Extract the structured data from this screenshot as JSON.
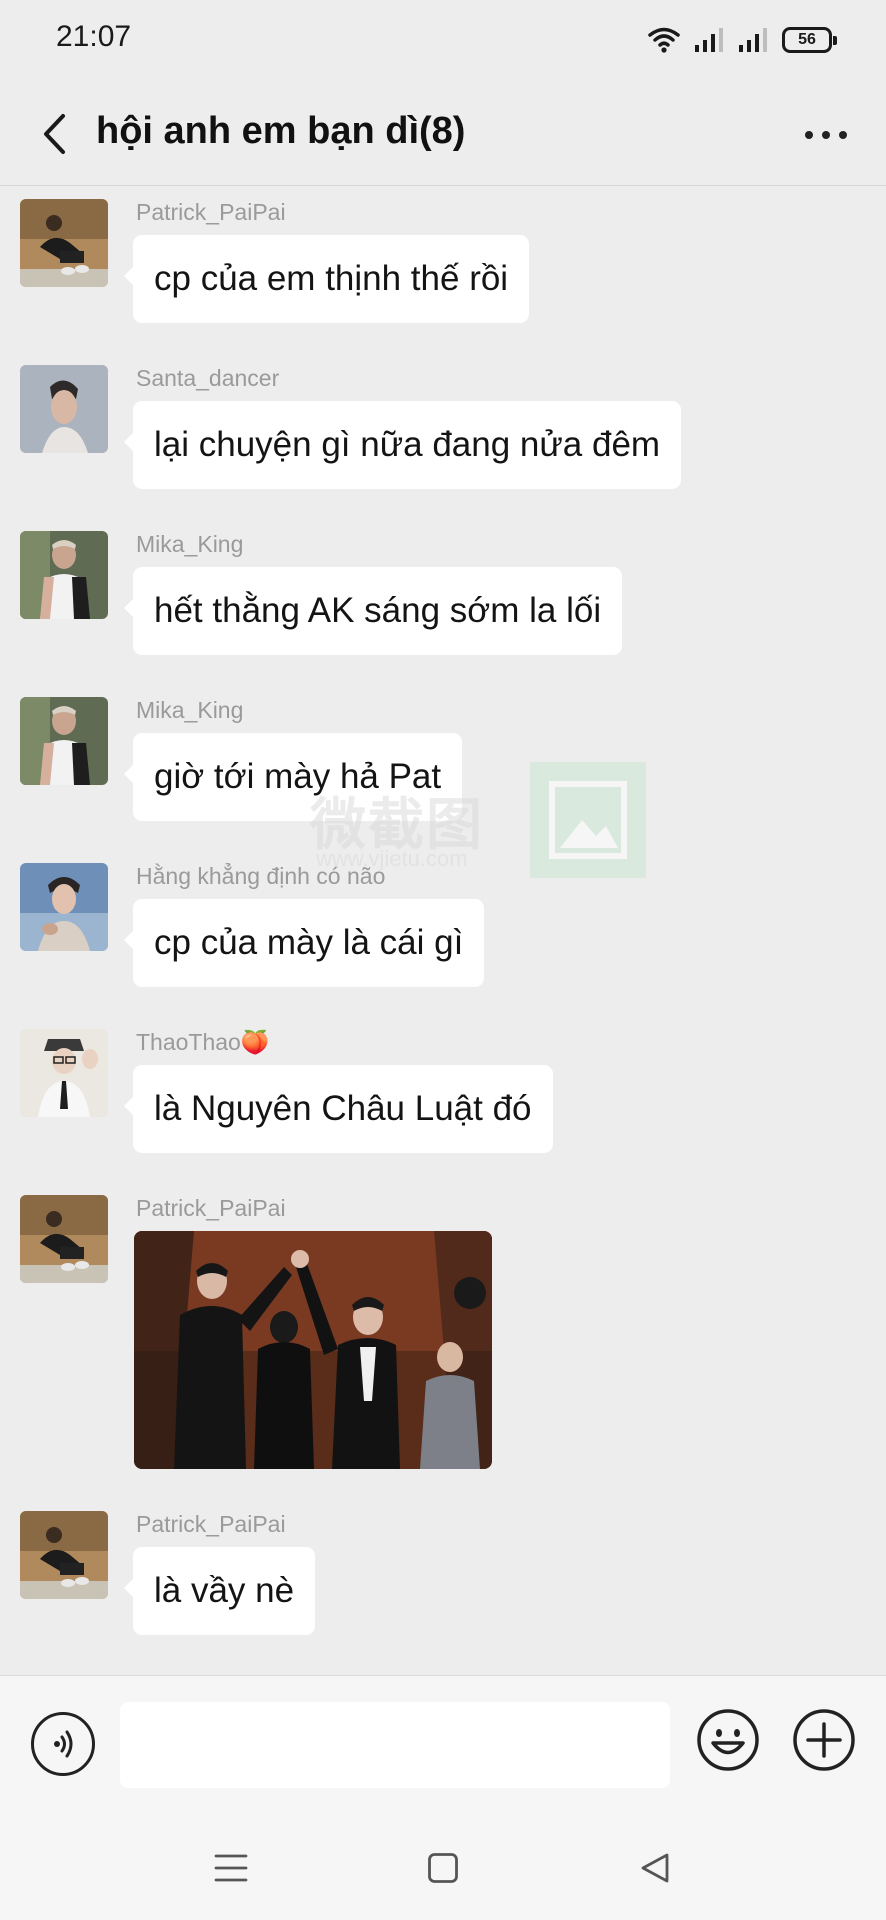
{
  "status_bar": {
    "time": "21:07",
    "battery": "56",
    "icons": [
      "wifi-icon",
      "signal-icon",
      "signal-icon",
      "battery-icon"
    ]
  },
  "header": {
    "title": "hội anh em bạn dì(8)",
    "back_icon": "chevron-left-icon",
    "more_icon": "more-horizontal-icon"
  },
  "messages": [
    {
      "sender": "Patrick_PaiPai",
      "text": "cp của em thịnh thế rồi"
    },
    {
      "sender": "Santa_dancer",
      "text": "lại chuyện gì nữa đang nửa đêm"
    },
    {
      "sender": "Mika_King",
      "text": "hết thằng AK sáng sớm la lối"
    },
    {
      "sender": "Mika_King",
      "text": "giờ tới mày hả Pat"
    },
    {
      "sender": "Hằng khẳng định có não",
      "text": "cp của mày là cái gì"
    },
    {
      "sender": "ThaoThao🍑",
      "text": "là Nguyên Châu Luật đó"
    },
    {
      "sender": "Patrick_PaiPai",
      "text": ""
    },
    {
      "sender": "Patrick_PaiPai",
      "text": "là vầy nè"
    }
  ],
  "watermark": {
    "text": "微截图",
    "url": "www.vjietu.com"
  },
  "input_bar": {
    "value": "",
    "placeholder": "",
    "voice_icon": "voice-icon",
    "emoji_icon": "emoji-icon",
    "plus_icon": "plus-icon"
  },
  "nav_bar": {
    "icons": [
      "menu-icon",
      "home-square-icon",
      "back-triangle-icon"
    ]
  }
}
